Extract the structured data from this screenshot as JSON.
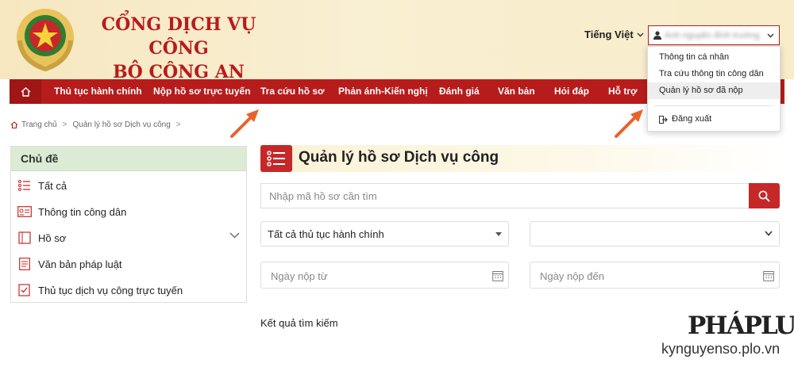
{
  "header": {
    "title_line1": "CỔNG DỊCH VỤ CÔNG",
    "title_line2": "BỘ CÔNG AN",
    "language": "Tiếng Việt",
    "user_name": "Ánh nguyễn đình trường"
  },
  "nav": {
    "items": [
      "Thủ tục hành chính",
      "Nộp hồ sơ trực tuyến",
      "Tra cứu hồ sơ",
      "Phản ánh-Kiến nghị",
      "Đánh giá",
      "Văn bản",
      "Hỏi đáp",
      "Hỗ trợ"
    ]
  },
  "user_menu": {
    "items": [
      "Thông tin cá nhân",
      "Tra cứu thông tin công dân",
      "Quản lý hồ sơ đã nộp"
    ],
    "logout": "Đăng xuất"
  },
  "breadcrumb": {
    "home": "Trang chủ",
    "current": "Quản lý hồ sơ Dịch vụ công"
  },
  "sidebar": {
    "heading": "Chủ đề",
    "items": [
      "Tất cả",
      "Thông tin công dân",
      "Hồ sơ",
      "Văn bản pháp luật",
      "Thủ tục dịch vụ công trực tuyến"
    ]
  },
  "main": {
    "title": "Quản lý hồ sơ Dịch vụ công",
    "search_placeholder": "Nhập mã hồ sơ cần tìm",
    "procedure_select": "Tất cả thủ tục hành chính",
    "second_select": "",
    "date_from_placeholder": "Ngày nộp từ",
    "date_to_placeholder": "Ngày nộp đến",
    "results_label": "Kết quả tìm kiếm"
  },
  "watermark": {
    "brand": "PHÁPLUẬT",
    "url": "kynguyenso.plo.vn"
  },
  "colors": {
    "primary_red": "#b71c1c",
    "accent_red": "#c62828",
    "arrow_orange": "#e8622c",
    "sidebar_header_green": "#dcebd4"
  }
}
